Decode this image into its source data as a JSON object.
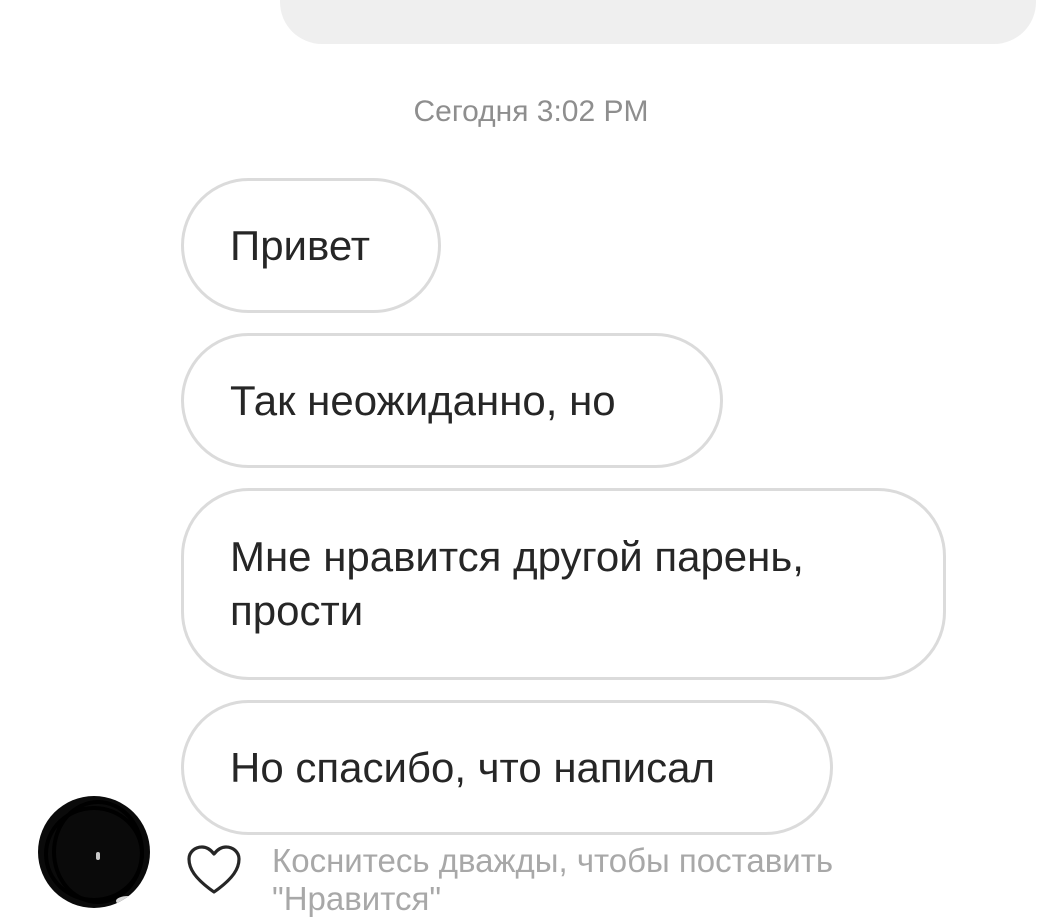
{
  "chat": {
    "timestamp": "Сегодня 3:02 PM",
    "messages": [
      {
        "text": "Привет"
      },
      {
        "text": "Так неожиданно, но"
      },
      {
        "text": "Мне нравится другой парень, прости"
      },
      {
        "text": "Но спасибо, что написал"
      }
    ],
    "like_hint": "Коснитесь дважды, чтобы поставить \"Нравится\""
  },
  "icons": {
    "like": "heart-outline-icon",
    "avatar": "avatar-redacted"
  },
  "colors": {
    "sent_bubble": "#efefef",
    "received_bubble_border": "#dbdbdb",
    "text": "#262626",
    "muted_text": "#8e8e8e"
  }
}
